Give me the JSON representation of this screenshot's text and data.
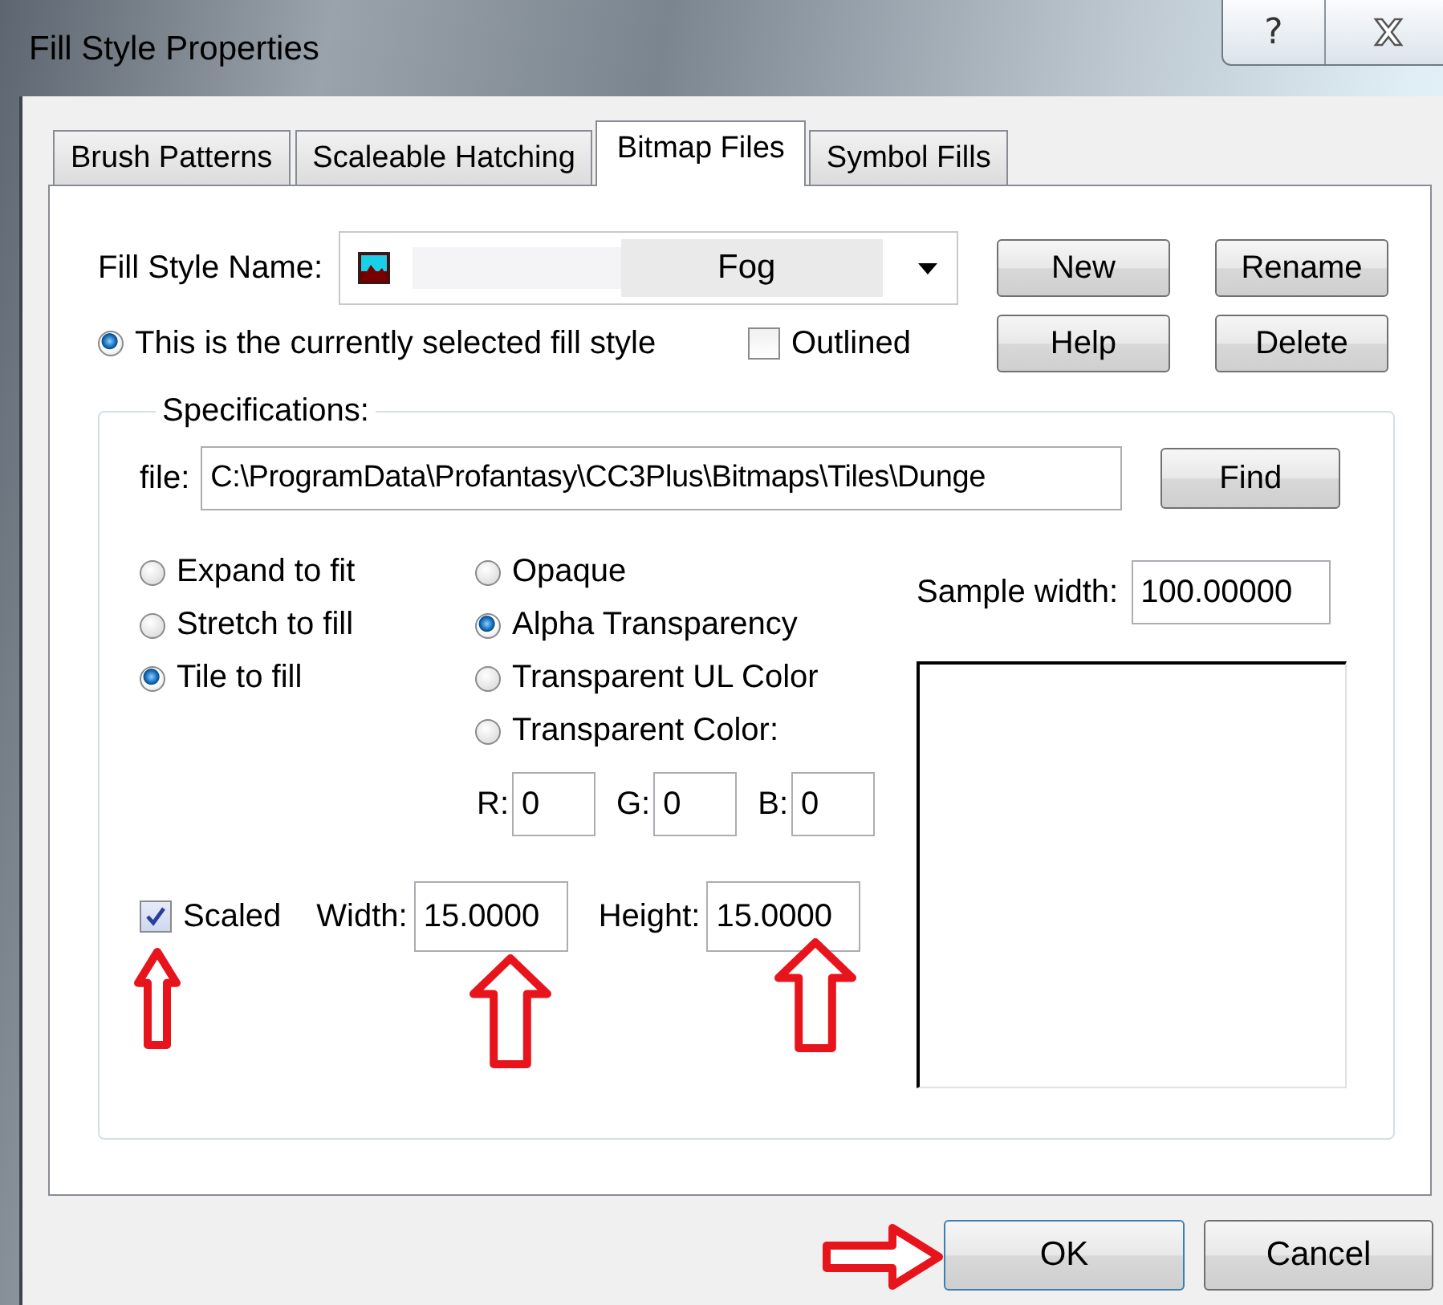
{
  "window": {
    "title": "Fill Style Properties"
  },
  "title_buttons": [
    {
      "kind": "help",
      "label": "?"
    },
    {
      "kind": "close"
    }
  ],
  "tabs": [
    {
      "label": "Brush Patterns",
      "selected": false
    },
    {
      "label": "Scaleable Hatching",
      "selected": false
    },
    {
      "label": "Bitmap Files",
      "selected": true
    },
    {
      "label": "Symbol Fills",
      "selected": false
    }
  ],
  "fill_style_name": {
    "label": "Fill Style Name:",
    "value": "Fog"
  },
  "side_buttons": [
    {
      "label": "New"
    },
    {
      "label": "Rename"
    },
    {
      "label": "Help"
    },
    {
      "label": "Delete"
    }
  ],
  "current_style": {
    "label": "This is the currently selected fill style",
    "selected": true
  },
  "outlined": {
    "label": "Outlined",
    "checked": false
  },
  "specifications": {
    "title": "Specifications:",
    "file": {
      "label": "file:",
      "value": "C:\\ProgramData\\Profantasy\\CC3Plus\\Bitmaps\\Tiles\\Dunge"
    },
    "find": "Find",
    "fit_options": [
      {
        "label": "Expand to fit",
        "selected": false
      },
      {
        "label": "Stretch to fill",
        "selected": false
      },
      {
        "label": "Tile to fill",
        "selected": true
      }
    ],
    "transparency_options": [
      {
        "label": "Opaque",
        "selected": false
      },
      {
        "label": "Alpha Transparency",
        "selected": true
      },
      {
        "label": "Transparent UL Color",
        "selected": false
      },
      {
        "label": "Transparent Color:",
        "selected": false
      }
    ],
    "rgb": [
      {
        "label": "R:",
        "value": "0"
      },
      {
        "label": "G:",
        "value": "0"
      },
      {
        "label": "B:",
        "value": "0"
      }
    ],
    "scaled": {
      "label": "Scaled",
      "checked": true
    },
    "width": {
      "label": "Width:",
      "value": "15.0000"
    },
    "height": {
      "label": "Height:",
      "value": "15.0000"
    },
    "sample_width": {
      "label": "Sample width:",
      "value": "100.00000"
    }
  },
  "dialog_buttons": [
    {
      "label": "OK"
    },
    {
      "label": "Cancel"
    }
  ],
  "annotation_arrows": [
    {
      "kind": "up"
    },
    {
      "kind": "up"
    },
    {
      "kind": "up"
    },
    {
      "kind": "right"
    }
  ]
}
